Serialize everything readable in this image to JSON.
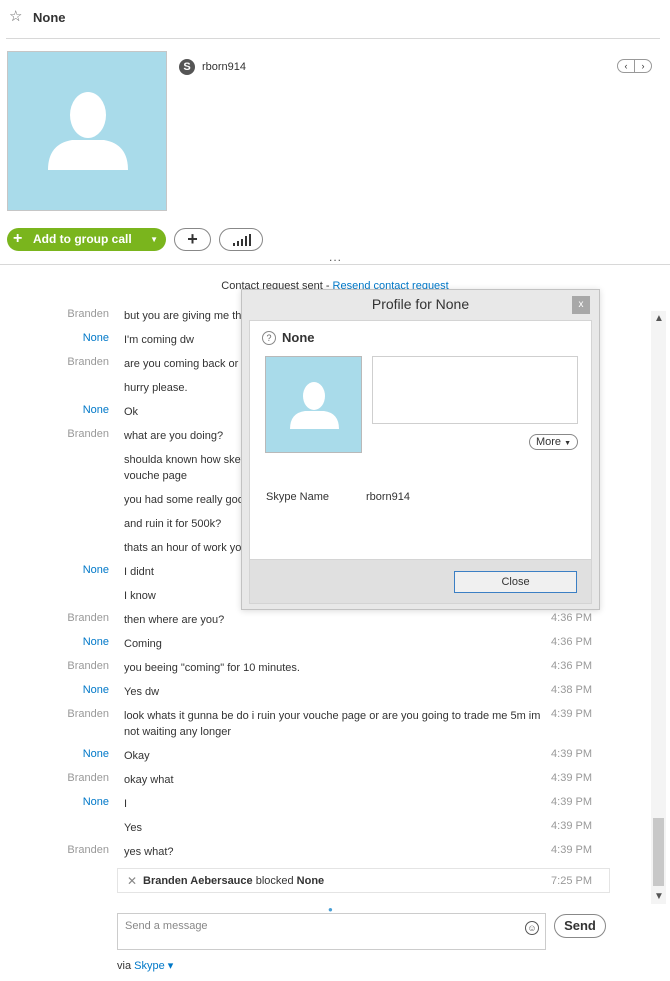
{
  "header": {
    "title": "None",
    "star_icon": "star-icon"
  },
  "profile": {
    "username": "rborn914",
    "status_icon": "skype-icon",
    "avatar_color": "#a9dbea"
  },
  "actions": {
    "group_call_label": "Add to group call",
    "add_icon": "plus-icon",
    "signal_icon": "signal-bars-icon",
    "more_dots": "..."
  },
  "request": {
    "text": "Contact request sent - ",
    "resend_link": "Resend contact request"
  },
  "messages": [
    {
      "who": "Branden",
      "text": "but you are giving me th",
      "time": ""
    },
    {
      "who": "None",
      "text": "I'm coming dw",
      "time": ""
    },
    {
      "who": "Branden",
      "text": "are you coming back or s",
      "time": ""
    },
    {
      "who": "",
      "text": "hurry please.",
      "time": ""
    },
    {
      "who": "None",
      "text": "Ok",
      "time": ""
    },
    {
      "who": "Branden",
      "text": "what are you doing?",
      "time": ""
    },
    {
      "who": "",
      "text": "shoulda known how sket",
      "text2": "vouche page",
      "time": ""
    },
    {
      "who": "",
      "text": "you had some really goo",
      "time": ""
    },
    {
      "who": "",
      "text": "and ruin it for 500k?",
      "time": ""
    },
    {
      "who": "",
      "text": "thats an hour of work yo",
      "time": ""
    },
    {
      "who": "None",
      "text": "I didnt",
      "time": ""
    },
    {
      "who": "",
      "text": "I know",
      "time": ""
    },
    {
      "who": "Branden",
      "text": "then where are you?",
      "time": "4:36 PM"
    },
    {
      "who": "None",
      "text": "Coming",
      "time": "4:36 PM"
    },
    {
      "who": "Branden",
      "text": "you beeing \"coming\" for 10 minutes.",
      "time": "4:36 PM"
    },
    {
      "who": "None",
      "text": "Yes dw",
      "time": "4:38 PM"
    },
    {
      "who": "Branden",
      "text": "look whats it gunna be do i ruin your vouche page or are you going to trade me 5m im",
      "text2": "not waiting any longer",
      "time": "4:39 PM"
    },
    {
      "who": "None",
      "text": "Okay",
      "time": "4:39 PM"
    },
    {
      "who": "Branden",
      "text": "okay what",
      "time": "4:39 PM"
    },
    {
      "who": "None",
      "text": "I",
      "time": "4:39 PM"
    },
    {
      "who": "",
      "text": "Yes",
      "time": "4:39 PM"
    },
    {
      "who": "Branden",
      "text": "yes what?",
      "time": "4:39 PM"
    }
  ],
  "blocked_notice": {
    "actor": "Branden Aebersauce",
    "verb": " blocked ",
    "target": "None",
    "time": "7:25 PM"
  },
  "composer": {
    "placeholder": "Send a message",
    "send_label": "Send",
    "via_label": "via ",
    "via_service": "Skype"
  },
  "dialog": {
    "title": "Profile for None",
    "close_x": "x",
    "name": "None",
    "more_label": "More",
    "field_label": "Skype Name",
    "field_value": "rborn914",
    "close_button": "Close"
  }
}
